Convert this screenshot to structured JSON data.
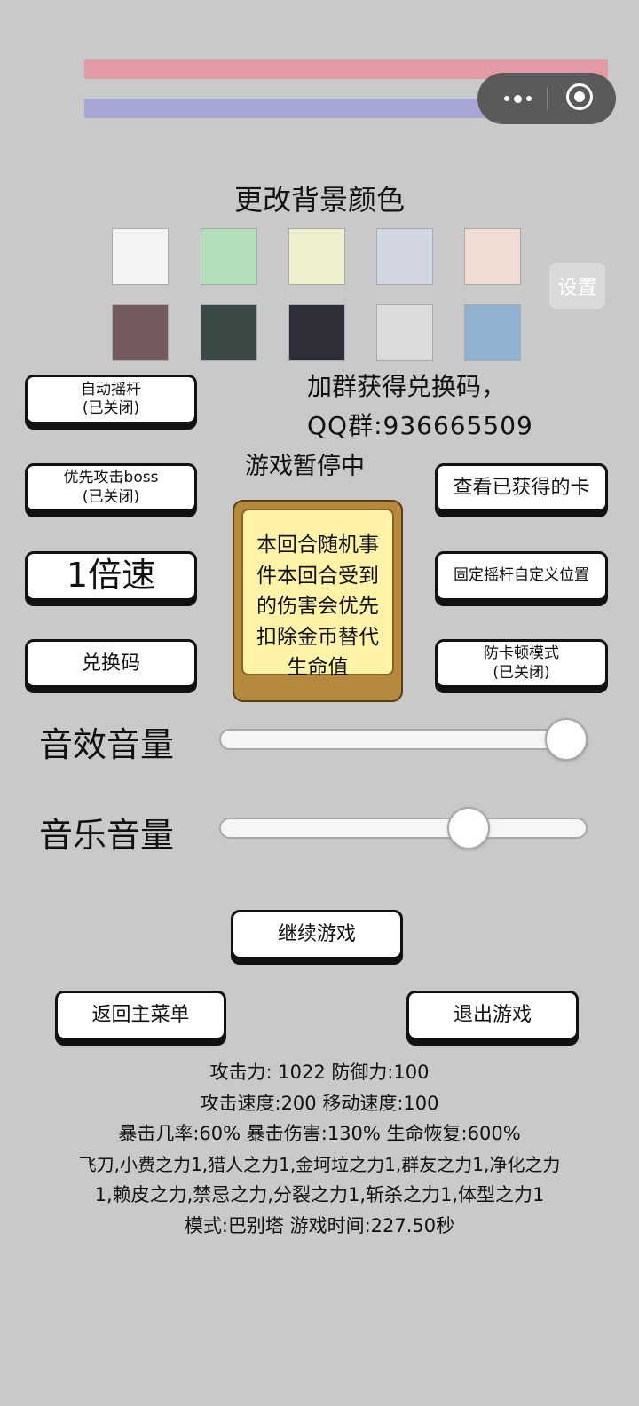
{
  "top_bars": {
    "hp_color": "#e39aa5",
    "mp_color": "#a6a6d6"
  },
  "capsule": {
    "menu_icon": "more-dots-icon",
    "close_icon": "target-circle-icon"
  },
  "background_color": {
    "title": "更改背景颜色",
    "swatches_row1": [
      "#f4f4f4",
      "#b2dfba",
      "#eeefcc",
      "#d2d6e3",
      "#f1dcd4"
    ],
    "swatches_row2": [
      "#725a5e",
      "#3a4946",
      "#2e2f38",
      "#dcdcdc",
      "#8fb1d2"
    ]
  },
  "settings_button": "设置",
  "qq_group": {
    "line1": "加群获得兑换码，",
    "line2": "QQ群:936665509"
  },
  "pause_status": "游戏暂停中",
  "left_buttons": {
    "auto_joystick": {
      "label": "自动摇杆",
      "state": "(已关闭)"
    },
    "priority_boss": {
      "label": "优先攻击boss",
      "state": "(已关闭)"
    },
    "speed": "1倍速",
    "redeem": "兑换码"
  },
  "right_buttons": {
    "view_cards": "查看已获得的卡",
    "fixed_joystick": "固定摇杆自定义位置",
    "anti_lag": {
      "label": "防卡顿模式",
      "state": "(已关闭)"
    }
  },
  "random_event": {
    "text": "本回合随机事件本回合受到的伤害会优先扣除金币替代生命值"
  },
  "volume": {
    "sfx_label": "音效音量",
    "sfx_value": 1.0,
    "music_label": "音乐音量",
    "music_value": 0.7
  },
  "actions": {
    "continue": "继续游戏",
    "main_menu": "返回主菜单",
    "exit": "退出游戏"
  },
  "stats": {
    "line1": "攻击力:  1022 防御力:100",
    "line2": "攻击速度:200 移动速度:100",
    "line3": "暴击几率:60% 暴击伤害:130% 生命恢复:600%",
    "line4": "飞刀,小费之力1,猎人之力1,金坷垃之力1,群友之力1,净化之力",
    "line5": "1,赖皮之力,禁忌之力,分裂之力1,斩杀之力1,体型之力1",
    "line6": "模式:巴别塔 游戏时间:227.50秒"
  }
}
